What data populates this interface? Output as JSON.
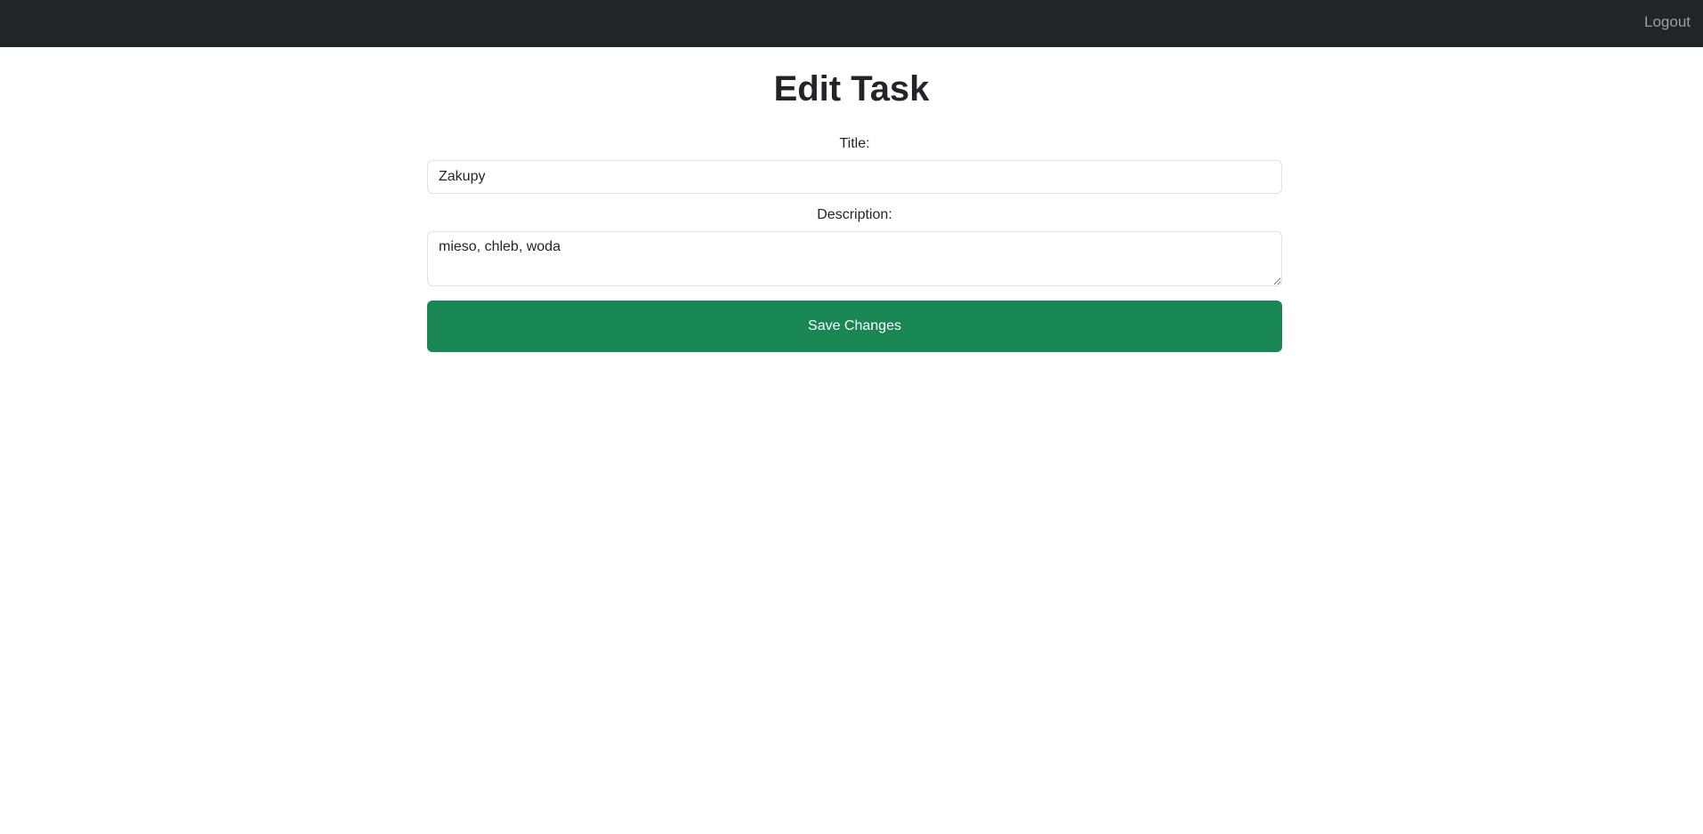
{
  "navbar": {
    "logout_label": "Logout"
  },
  "page": {
    "title": "Edit Task"
  },
  "form": {
    "title_label": "Title:",
    "title_value": "Zakupy",
    "description_label": "Description:",
    "description_value": "mieso, chleb, woda",
    "save_label": "Save Changes"
  },
  "colors": {
    "navbar_bg": "#212529",
    "save_button_bg": "#198754",
    "text": "#212529"
  }
}
